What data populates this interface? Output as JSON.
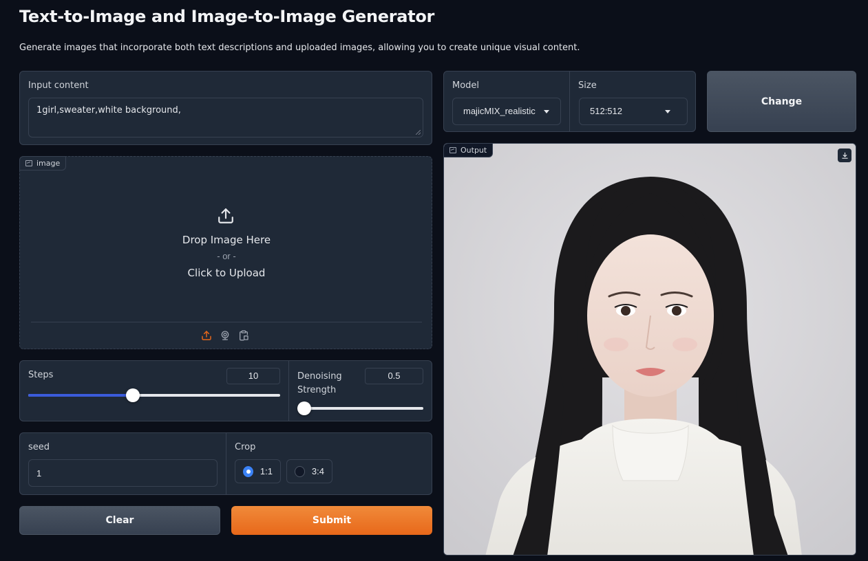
{
  "header": {
    "title": "Text-to-Image and Image-to-Image Generator",
    "subtitle": "Generate images that incorporate both text descriptions and uploaded images, allowing you to create unique visual content."
  },
  "input_content": {
    "label": "Input content",
    "value": "1girl,sweater,white background,"
  },
  "image_upload": {
    "tag_label": "image",
    "drop_text": "Drop Image Here",
    "or_text": "- or -",
    "click_text": "Click to Upload",
    "sources": [
      "upload-icon",
      "webcam-icon",
      "clipboard-icon"
    ]
  },
  "steps": {
    "label": "Steps",
    "value": "10",
    "fraction": 0.41
  },
  "denoising": {
    "label": "Denoising Strength",
    "label_line1": "Denoising",
    "label_line2": "Strength",
    "value": "0.5",
    "fraction": 0.0
  },
  "seed": {
    "label": "seed",
    "value": "1"
  },
  "crop": {
    "label": "Crop",
    "options": [
      {
        "label": "1:1",
        "selected": true
      },
      {
        "label": "3:4",
        "selected": false
      }
    ]
  },
  "buttons": {
    "clear": "Clear",
    "submit": "Submit",
    "change": "Change"
  },
  "model": {
    "label": "Model",
    "value": "majicMIX_realistic"
  },
  "size": {
    "label": "Size",
    "value": "512:512"
  },
  "output": {
    "tag_label": "Output"
  },
  "colors": {
    "accent": "#e8681a",
    "slider": "#3b5bdb",
    "radio": "#3b82f6",
    "background": "#0b0f19",
    "panel": "#1f2937"
  }
}
